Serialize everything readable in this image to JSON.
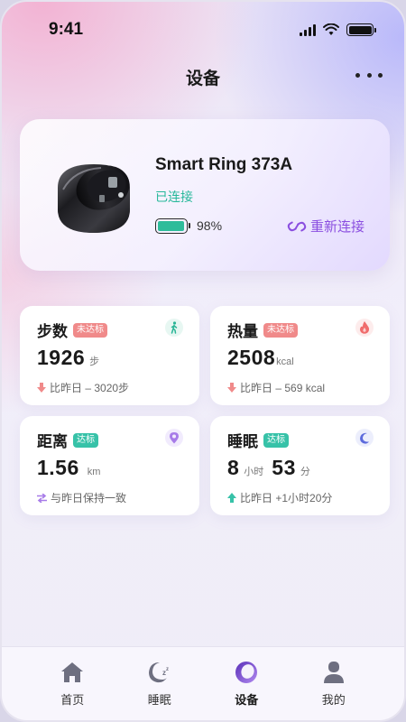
{
  "status_bar": {
    "time": "9:41"
  },
  "header": {
    "title": "设备"
  },
  "device": {
    "name": "Smart Ring 373A",
    "status": "已连接",
    "battery_level": 0.98,
    "battery_text": "98%",
    "reconnect_label": "重新连接"
  },
  "stats": {
    "steps": {
      "title": "步数",
      "badge": "未达标",
      "value": "1926",
      "unit": "步",
      "compare": "比昨日 – 3020步",
      "trend": "down"
    },
    "calories": {
      "title": "热量",
      "badge": "未达标",
      "value": "2508",
      "unit": "kcal",
      "compare": "比昨日 – 569 kcal",
      "trend": "down"
    },
    "distance": {
      "title": "距离",
      "badge": "达标",
      "value": "1.56",
      "unit": "km",
      "compare": "与昨日保持一致",
      "trend": "equal"
    },
    "sleep": {
      "title": "睡眠",
      "badge": "达标",
      "value_hours": "8",
      "unit_hours": "小时",
      "value_minutes": "53",
      "unit_minutes": "分",
      "compare": "比昨日 +1小时20分",
      "trend": "up"
    }
  },
  "tabs": [
    {
      "label": "首页",
      "icon": "home-icon",
      "active": false
    },
    {
      "label": "睡眠",
      "icon": "sleep-icon",
      "active": false
    },
    {
      "label": "设备",
      "icon": "ring-icon",
      "active": true
    },
    {
      "label": "我的",
      "icon": "profile-icon",
      "active": false
    }
  ],
  "colors": {
    "accent": "#8b4fe0",
    "connected": "#27b89a",
    "badge_not_met": "#f08a8a",
    "badge_met": "#37c2a8"
  }
}
